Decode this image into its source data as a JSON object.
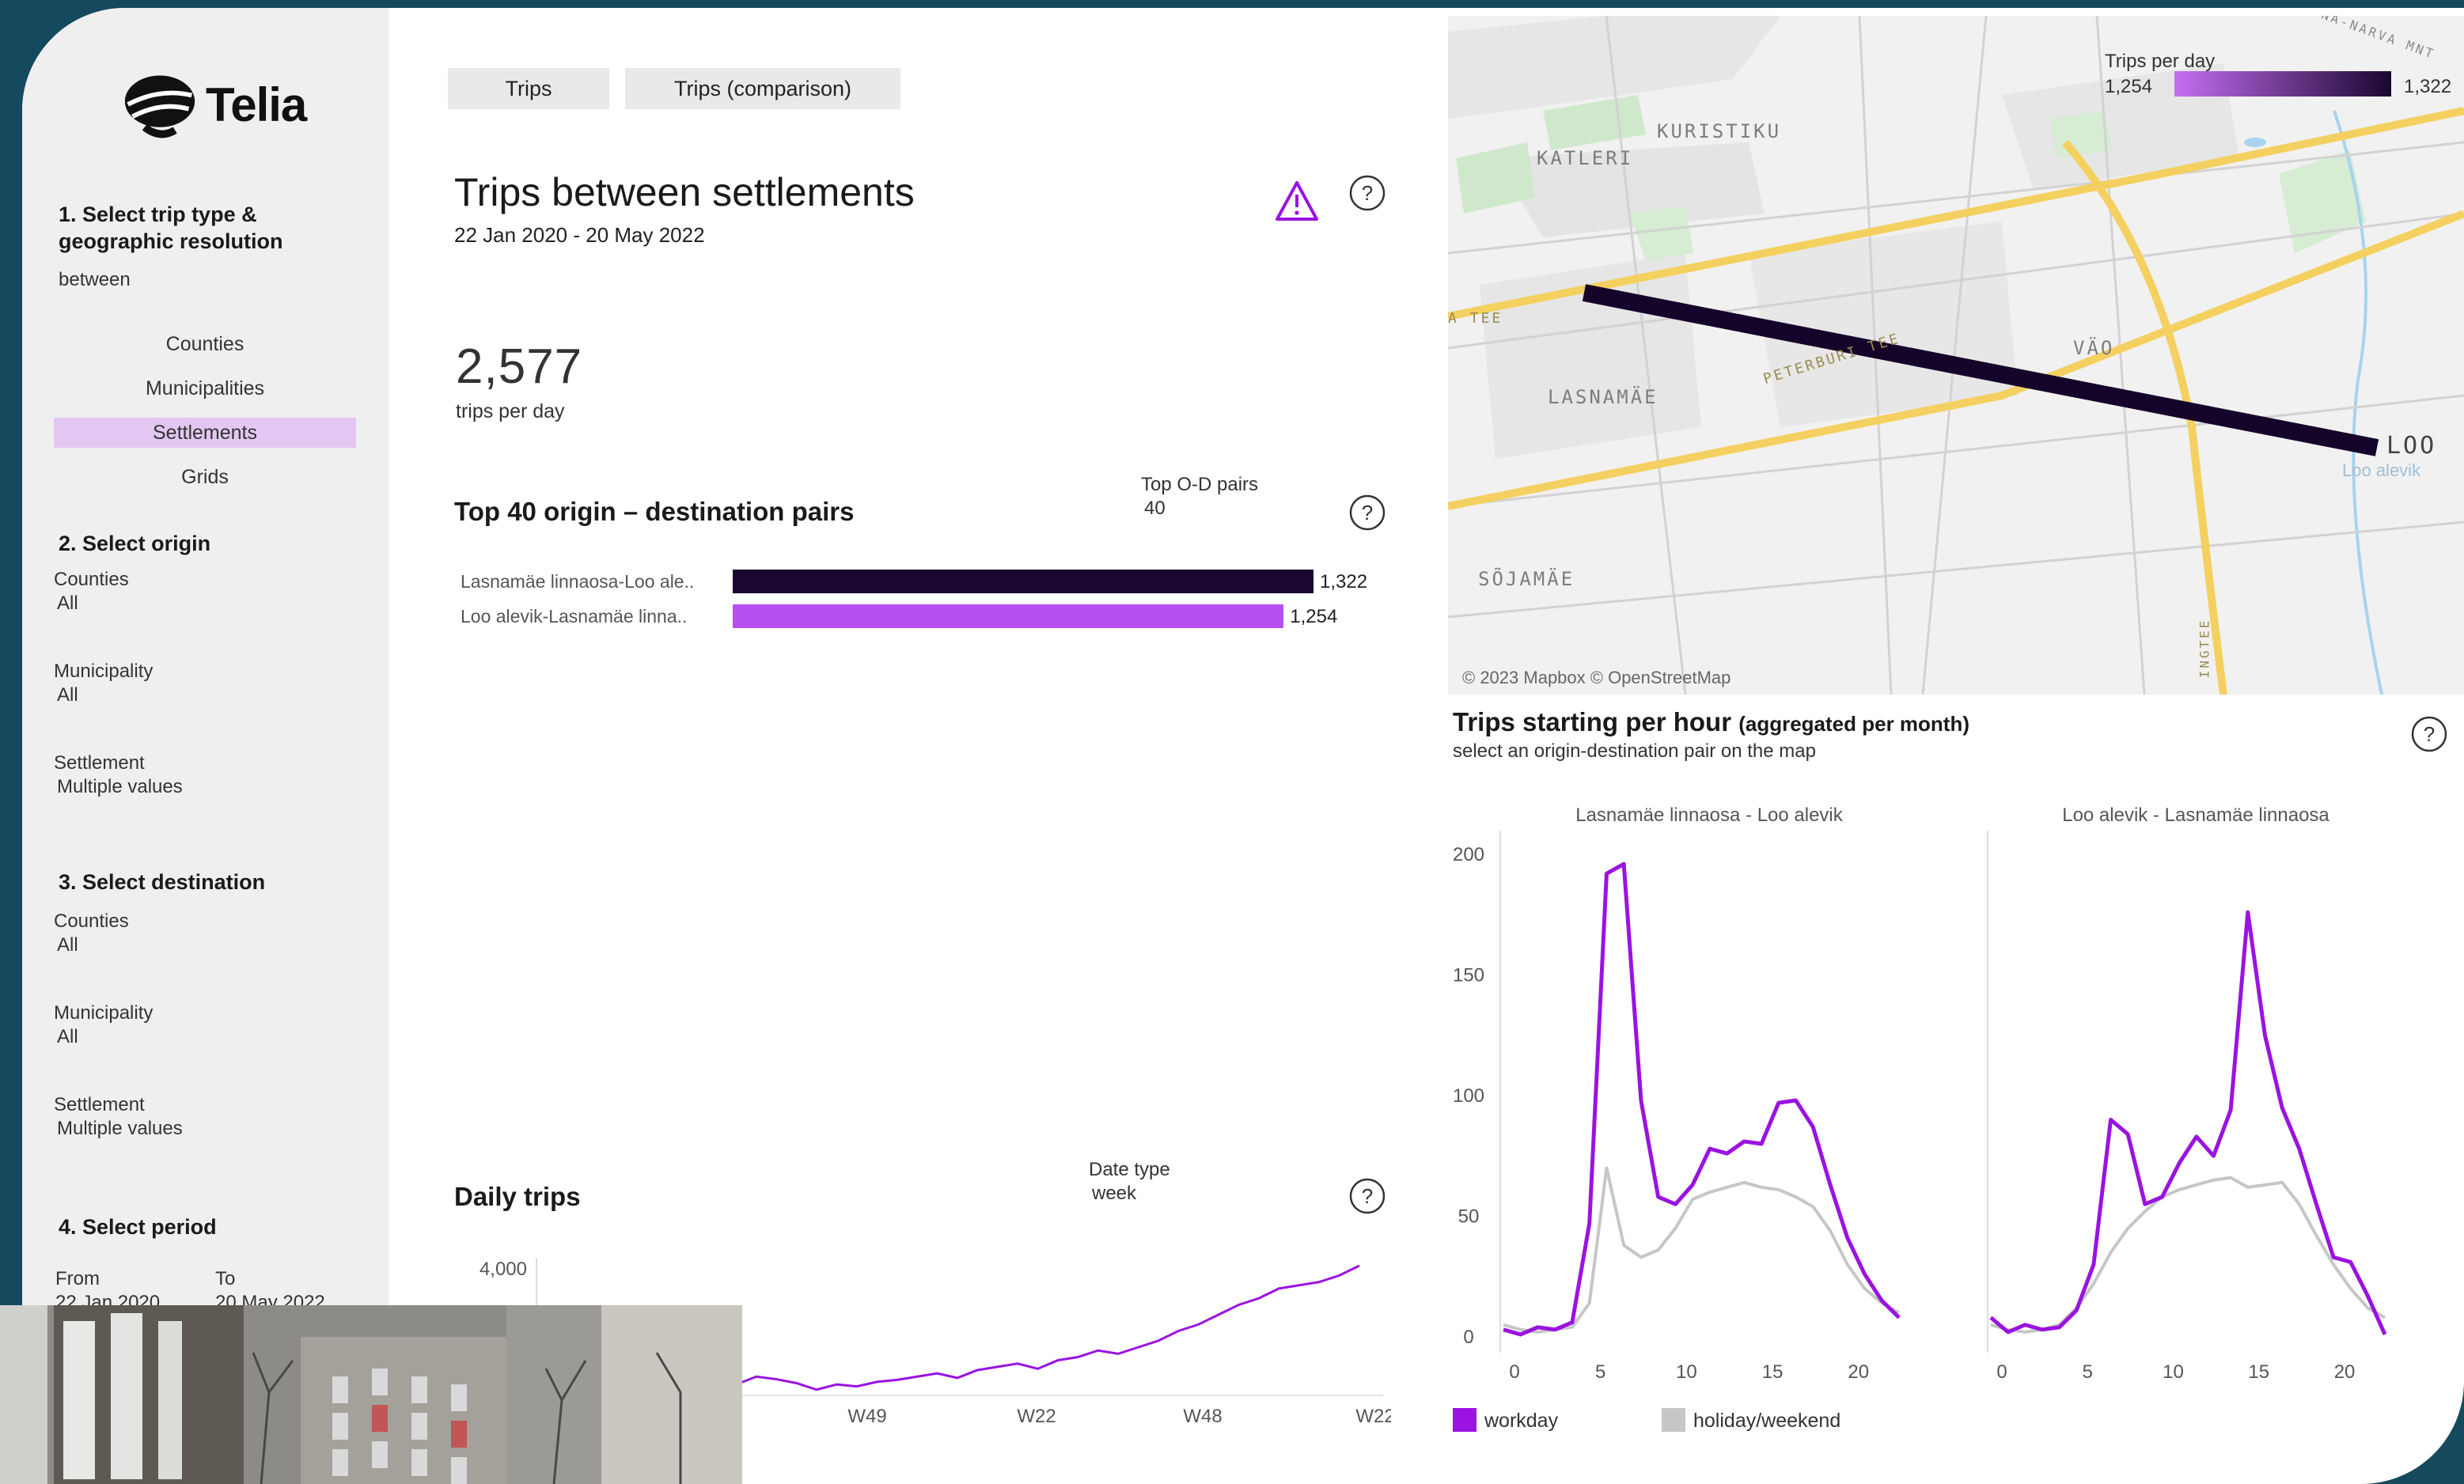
{
  "brand": {
    "name": "Telia",
    "color": "#990ae3"
  },
  "sidebar": {
    "step1": {
      "title": "1. Select trip type & geographic resolution",
      "trip_type": "between",
      "resolutions": [
        "Counties",
        "Municipalities",
        "Settlements",
        "Grids"
      ],
      "selected": "Settlements"
    },
    "step2": {
      "title": "2. Select origin",
      "filters": [
        {
          "label": "Counties",
          "value": "All"
        },
        {
          "label": "Municipality",
          "value": "All"
        },
        {
          "label": "Settlement",
          "value": "Multiple values"
        }
      ]
    },
    "step3": {
      "title": "3. Select destination",
      "filters": [
        {
          "label": "Counties",
          "value": "All"
        },
        {
          "label": "Municipality",
          "value": "All"
        },
        {
          "label": "Settlement",
          "value": "Multiple values"
        }
      ]
    },
    "step4": {
      "title": "4. Select period",
      "from_label": "From",
      "from_value": "22 Jan 2020",
      "to_label": "To",
      "to_value": "20 May 2022"
    }
  },
  "tabs": [
    "Trips",
    "Trips (comparison)"
  ],
  "header": {
    "title": "Trips between settlements",
    "date_range": "22 Jan 2020 - 20 May 2022",
    "warning_icon": "warning-triangle-icon",
    "help_icon": "question-circle-icon"
  },
  "kpi": {
    "value": "2,577",
    "label": "trips per day"
  },
  "od_pairs": {
    "title": "Top 40 origin – destination pairs",
    "param_label": "Top O-D pairs",
    "param_value": "40",
    "chart_data": {
      "type": "bar",
      "categories": [
        "Lasnamäe linnaosa-Loo ale..",
        "Loo alevik-Lasnamäe linna.."
      ],
      "values": [
        1322,
        1254
      ],
      "value_labels": [
        "1,322",
        "1,254"
      ],
      "colors": [
        "#1a0630",
        "#b750ee"
      ]
    }
  },
  "map": {
    "legend_title": "Trips per day",
    "legend_min": "1,254",
    "legend_max": "1,322",
    "labels": [
      "KURISTIKU",
      "KATLERI",
      "LASNAMÄE",
      "VÄO",
      "SÕJAMÄE",
      "LOO",
      "Loo alevik",
      "PETERBURI TEE",
      "A TEE",
      "NA-NARVA MNT",
      "INGTEE"
    ],
    "attribution": "© 2023 Mapbox © OpenStreetMap"
  },
  "daily_trips": {
    "title": "Daily trips",
    "param_label": "Date type",
    "param_value": "week",
    "chart_data": {
      "type": "line",
      "x": [
        "W49",
        "W22",
        "W48",
        "W22"
      ],
      "ytick": "4,000",
      "series": [
        {
          "values": [
            2350,
            2420,
            2300,
            2150,
            2250,
            2200,
            2180,
            2300,
            2260,
            2200,
            2100,
            2180,
            2150,
            2220,
            2250,
            2300,
            2350,
            2280,
            2400,
            2450,
            2500,
            2420,
            2550,
            2600,
            2700,
            2650,
            2750,
            2850,
            3000,
            3100,
            3250,
            3400,
            3500,
            3650,
            3700,
            3750,
            3850,
            4000
          ]
        }
      ]
    }
  },
  "hourly": {
    "title": "Trips starting per hour",
    "title_suffix": "(aggregated per month)",
    "subtitle": "select an origin-destination pair on the map",
    "chart_data": [
      {
        "type": "line",
        "title": "Lasnamäe linnaosa - Loo alevik",
        "x": [
          0,
          1,
          2,
          3,
          4,
          5,
          6,
          7,
          8,
          9,
          10,
          11,
          12,
          13,
          14,
          15,
          16,
          17,
          18,
          19,
          20,
          21,
          22,
          23
        ],
        "ylim": [
          0,
          200
        ],
        "yticks": [
          "0",
          "50",
          "100",
          "150",
          "200"
        ],
        "xticks": [
          "0",
          "5",
          "10",
          "15",
          "20"
        ],
        "series": [
          {
            "name": "workday",
            "values": [
              3,
              1,
              4,
              3,
              6,
              47,
              192,
              196,
              98,
              58,
              55,
              63,
              78,
              76,
              81,
              80,
              97,
              98,
              87,
              63,
              41,
              26,
              15,
              8
            ]
          },
          {
            "name": "holiday/weekend",
            "values": [
              5,
              3,
              2,
              3,
              4,
              14,
              70,
              38,
              33,
              36,
              45,
              57,
              60,
              62,
              64,
              62,
              61,
              58,
              54,
              44,
              30,
              20,
              14,
              10
            ]
          }
        ]
      },
      {
        "type": "line",
        "title": "Loo alevik - Lasnamäe linnaosa",
        "x": [
          0,
          1,
          2,
          3,
          4,
          5,
          6,
          7,
          8,
          9,
          10,
          11,
          12,
          13,
          14,
          15,
          16,
          17,
          18,
          19,
          20,
          21,
          22,
          23
        ],
        "ylim": [
          0,
          200
        ],
        "yticks": [
          "0",
          "50",
          "100",
          "150",
          "200"
        ],
        "xticks": [
          "0",
          "5",
          "10",
          "15",
          "20"
        ],
        "series": [
          {
            "name": "workday",
            "values": [
              8,
              2,
              5,
              3,
              4,
              11,
              30,
              90,
              84,
              55,
              58,
              72,
              83,
              75,
              94,
              176,
              125,
              95,
              78,
              55,
              33,
              31,
              17,
              1
            ]
          },
          {
            "name": "holiday/weekend",
            "values": [
              5,
              3,
              2,
              3,
              5,
              12,
              22,
              35,
              45,
              52,
              58,
              61,
              63,
              65,
              66,
              62,
              63,
              64,
              55,
              42,
              30,
              20,
              12,
              8
            ]
          }
        ]
      }
    ],
    "legend": [
      {
        "label": "workday",
        "color": "#9a13e0"
      },
      {
        "label": "holiday/weekend",
        "color": "#c6c6c6"
      }
    ]
  },
  "colors": {
    "purple": "#9a13e0",
    "dark": "#1a0630",
    "light_purple": "#b750ee",
    "grey": "#c6c6c6",
    "selected_bg": "#e3c7f2"
  }
}
